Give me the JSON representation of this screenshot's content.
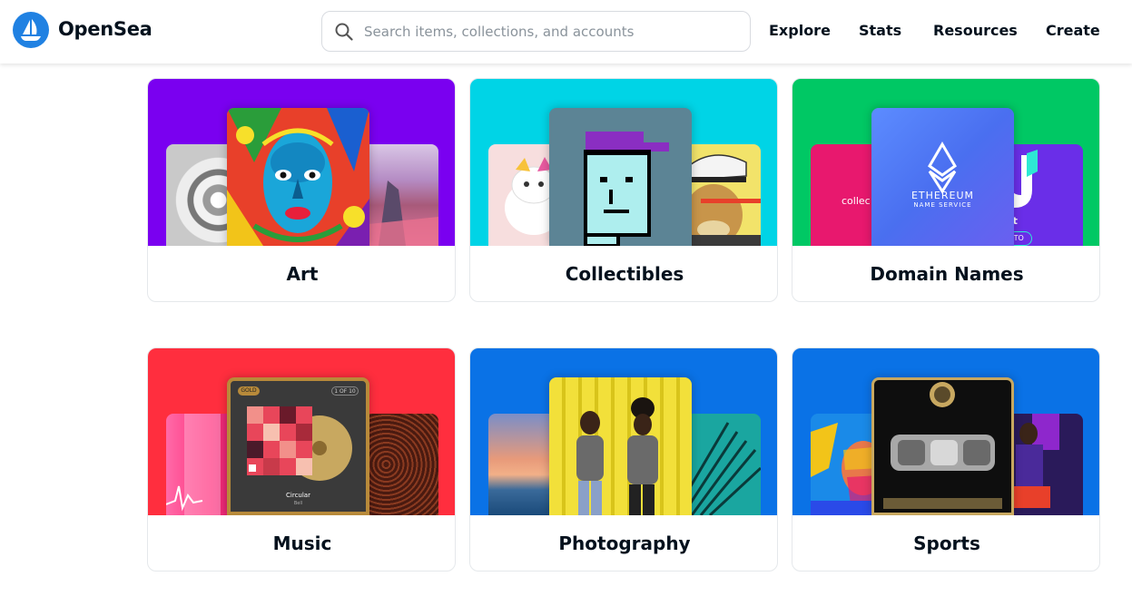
{
  "app": {
    "brand": "OpenSea"
  },
  "search": {
    "placeholder": "Search items, collections, and accounts"
  },
  "nav": {
    "items": [
      {
        "label": "Explore"
      },
      {
        "label": "Stats"
      },
      {
        "label": "Resources"
      },
      {
        "label": "Create"
      }
    ]
  },
  "categories": [
    {
      "label": "Art",
      "color": "#7a00f0"
    },
    {
      "label": "Collectibles",
      "color": "#00d4e6"
    },
    {
      "label": "Domain Names",
      "color": "#00c864"
    },
    {
      "label": "Music",
      "color": "#ff2e3e"
    },
    {
      "label": "Photography",
      "color": "#0a72e6"
    },
    {
      "label": "Sports",
      "color": "#0a72e6"
    }
  ],
  "domain_card": {
    "left_text": "collec",
    "ens_title": "ETHEREUM",
    "ens_subtitle": "NAME SERVICE",
    "right_text": "nft",
    "right_pill": "CRYPTO"
  },
  "music_card": {
    "badge_left": "GOLD",
    "badge_right": "1 OF 10",
    "track_title": "Circular",
    "track_artist": "Bell"
  }
}
